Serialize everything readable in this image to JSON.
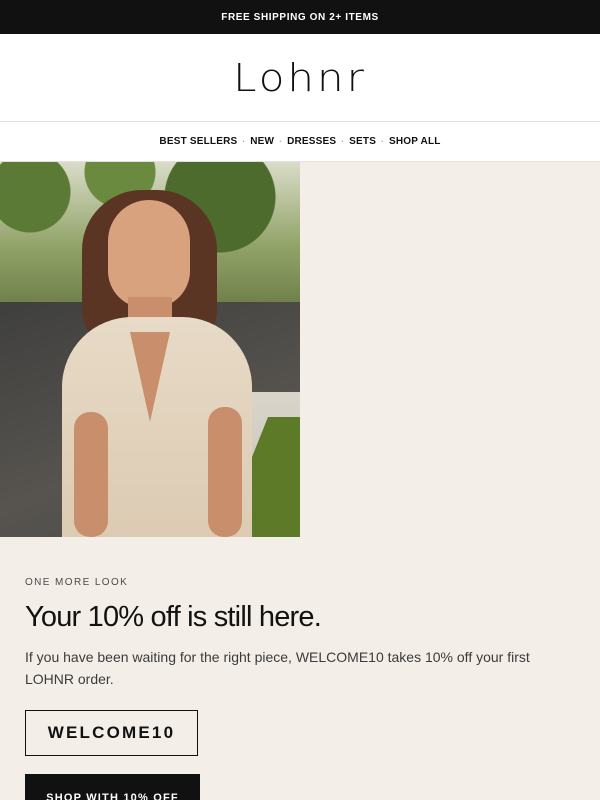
{
  "announcement": {
    "text": "FREE SHIPPING ON 2+ ITEMS"
  },
  "brand": {
    "logo_text": "Lohnr"
  },
  "nav": {
    "items": [
      "BEST SELLERS",
      "NEW",
      "DRESSES",
      "SETS",
      "SHOP ALL"
    ],
    "separator": "·"
  },
  "hero": {
    "image_alt": "Woman in a cream dress on a suburban street"
  },
  "content": {
    "eyebrow": "ONE MORE LOOK",
    "headline": "Your 10% off is still here.",
    "body": "If you have been waiting for the right piece, WELCOME10 takes 10% off your first LOHNR order.",
    "code": "WELCOME10",
    "cta_label": "SHOP WITH 10% OFF"
  },
  "colors": {
    "announcement_bg": "#111111",
    "page_bg": "#f3efe8",
    "cta_bg": "#111111"
  }
}
